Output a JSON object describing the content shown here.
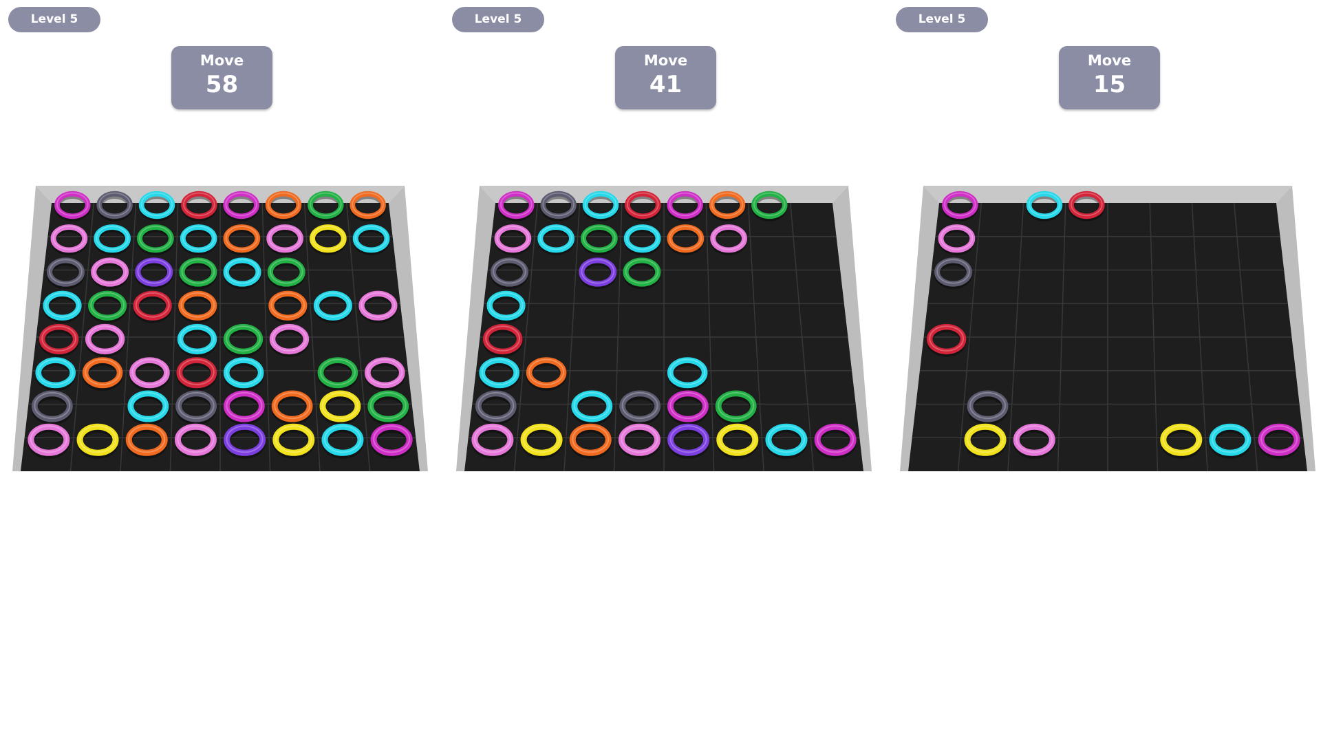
{
  "palette": {
    "M": "#cf2fc6",
    "K": "#5c5b70",
    "C": "#25d8ea",
    "R": "#d4243a",
    "O": "#f06a1f",
    "G": "#21b144",
    "P": "#e678da",
    "Y": "#f2e21c",
    "V": "#7d3fe0"
  },
  "panels": [
    {
      "level_label": "Level 5",
      "move_label": "Move",
      "move_count": "58",
      "grid": [
        "MKCRMOGO",
        "PCGCOPYC",
        "KPVGCG..",
        "CGRO.OCP",
        "RP.CGP..",
        "COPRC.GP",
        "K.CKMOYG",
        "PYOPVYCM"
      ]
    },
    {
      "level_label": "Level 5",
      "move_label": "Move",
      "move_count": "41",
      "grid": [
        "MKCRMOG.",
        "PCGCOP..",
        "K.VG....",
        "C.......",
        "R.......",
        "CO..C...",
        "K.CKMG..",
        "PYOPVYCM"
      ]
    },
    {
      "level_label": "Level 5",
      "move_label": "Move",
      "move_count": "15",
      "grid": [
        "M.CR....",
        "P.......",
        "K.......",
        "........",
        "R.......",
        "........",
        ".K......",
        ".YP..YCM"
      ]
    }
  ]
}
